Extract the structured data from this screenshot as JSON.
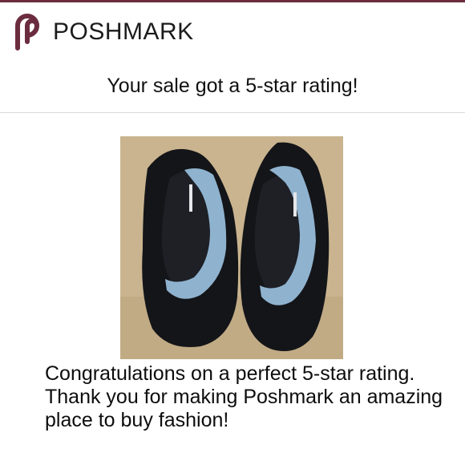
{
  "brand": {
    "name": "POSHMARK",
    "logo_icon": "poshmark-logo-icon",
    "color": "#6b2c3f"
  },
  "notification": {
    "headline": "Your sale got a 5-star rating!",
    "message": "Congratulations on a perfect 5-star rating. Thank you for making Poshmark an amazing place to buy fashion!"
  },
  "product_photo": {
    "subject": "black water shoes with light blue mesh",
    "background_color": "#c9b48f"
  }
}
